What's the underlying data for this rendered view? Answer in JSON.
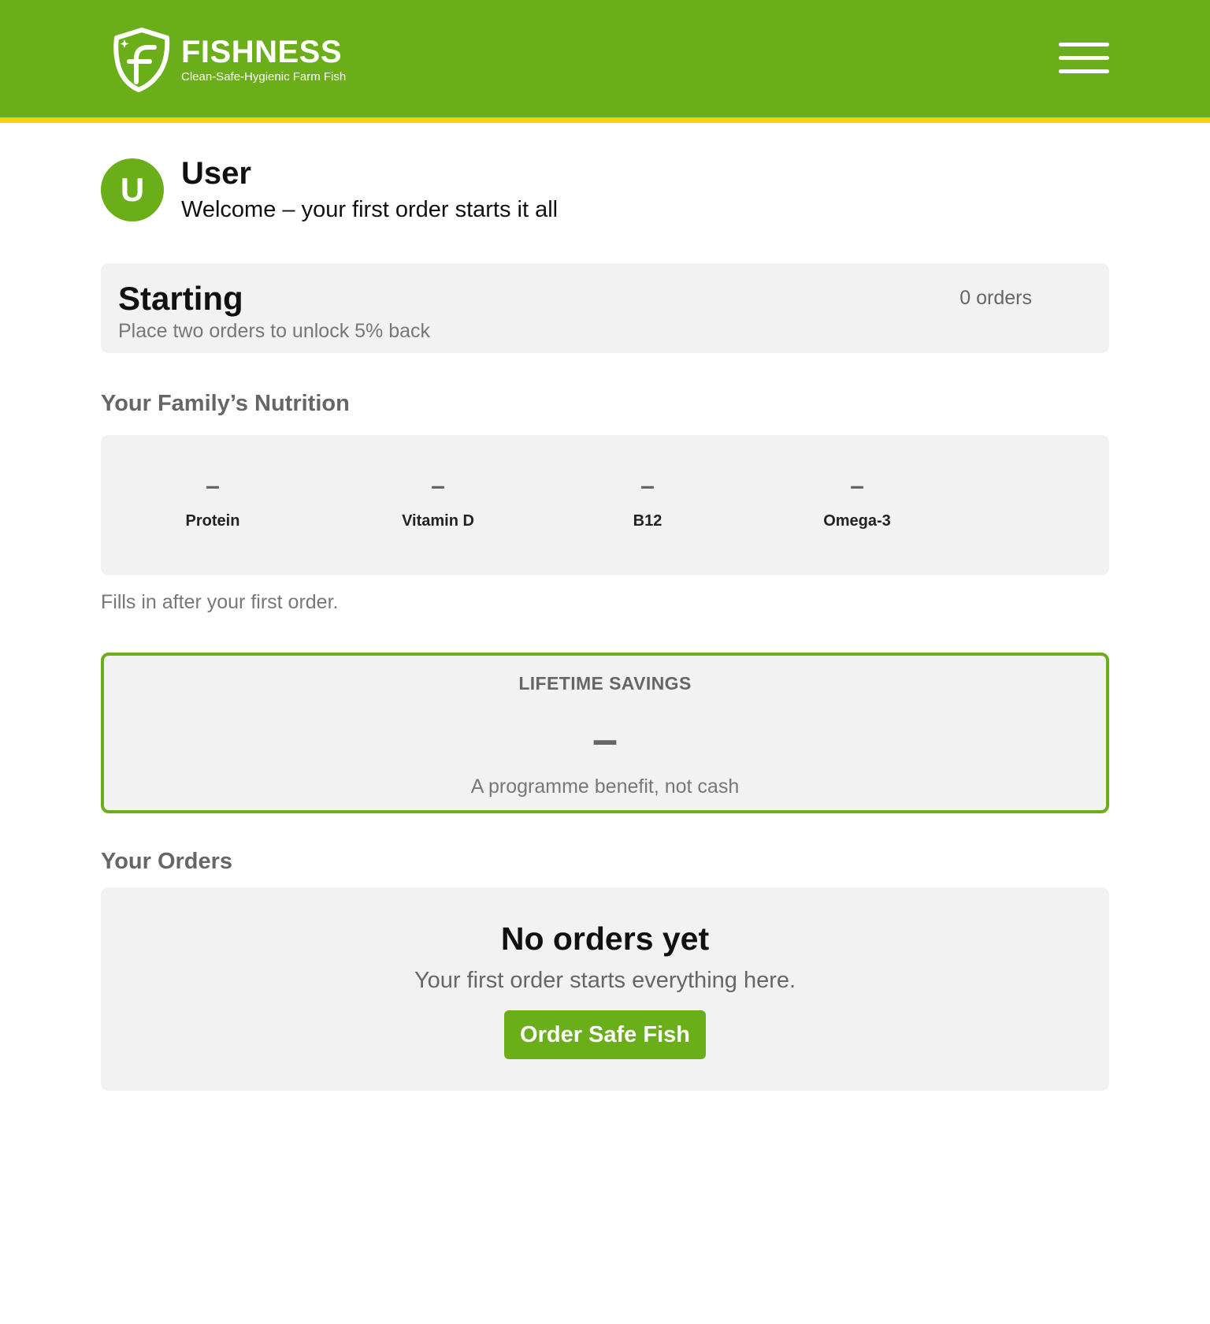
{
  "header": {
    "brand_name": "FISHNESS",
    "tagline": "Clean-Safe-Hygienic Farm Fish",
    "logo_icon": "shield-f-logo",
    "menu_icon": "hamburger-menu-icon"
  },
  "profile": {
    "avatar_initial": "U",
    "name": "User",
    "welcome": "Welcome – your first order starts it all"
  },
  "tier": {
    "name": "Starting",
    "description": "Place two orders to unlock 5% back",
    "order_count": "0 orders"
  },
  "nutrition": {
    "title": "Your Family’s Nutrition",
    "items": [
      {
        "value": "–",
        "label": "Protein"
      },
      {
        "value": "–",
        "label": "Vitamin D"
      },
      {
        "value": "–",
        "label": "B12"
      },
      {
        "value": "–",
        "label": "Omega-3"
      }
    ],
    "note": "Fills in after your first order."
  },
  "savings": {
    "label": "LIFETIME SAVINGS",
    "value": "–",
    "note": "A programme benefit, not cash"
  },
  "orders": {
    "title": "Your Orders",
    "empty_title": "No orders yet",
    "empty_text": "Your first order starts everything here.",
    "cta_label": "Order Safe Fish"
  },
  "colors": {
    "brand_green": "#6aaf19",
    "accent_yellow": "#f2d40c",
    "card_background": "#f2f2f2",
    "muted_text": "#666666"
  }
}
